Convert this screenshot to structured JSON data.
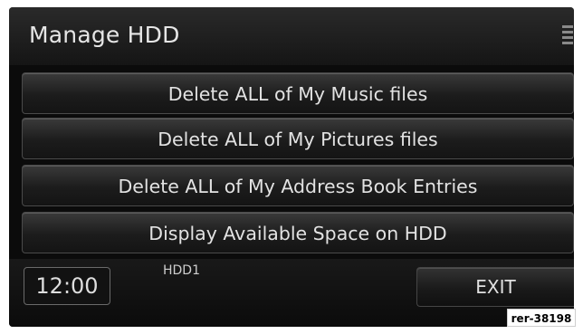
{
  "header": {
    "title": "Manage HDD",
    "status_icon": "hdd-stack-icon"
  },
  "menu": {
    "items": [
      {
        "label": "Delete ALL of My Music files"
      },
      {
        "label": "Delete ALL of My Pictures files"
      },
      {
        "label": "Delete ALL of My Address Book Entries"
      },
      {
        "label": "Display Available Space on HDD"
      }
    ]
  },
  "footer": {
    "clock": "12:00",
    "source_label": "HDD1",
    "exit_label": "EXIT"
  },
  "reference": "rer-38198"
}
